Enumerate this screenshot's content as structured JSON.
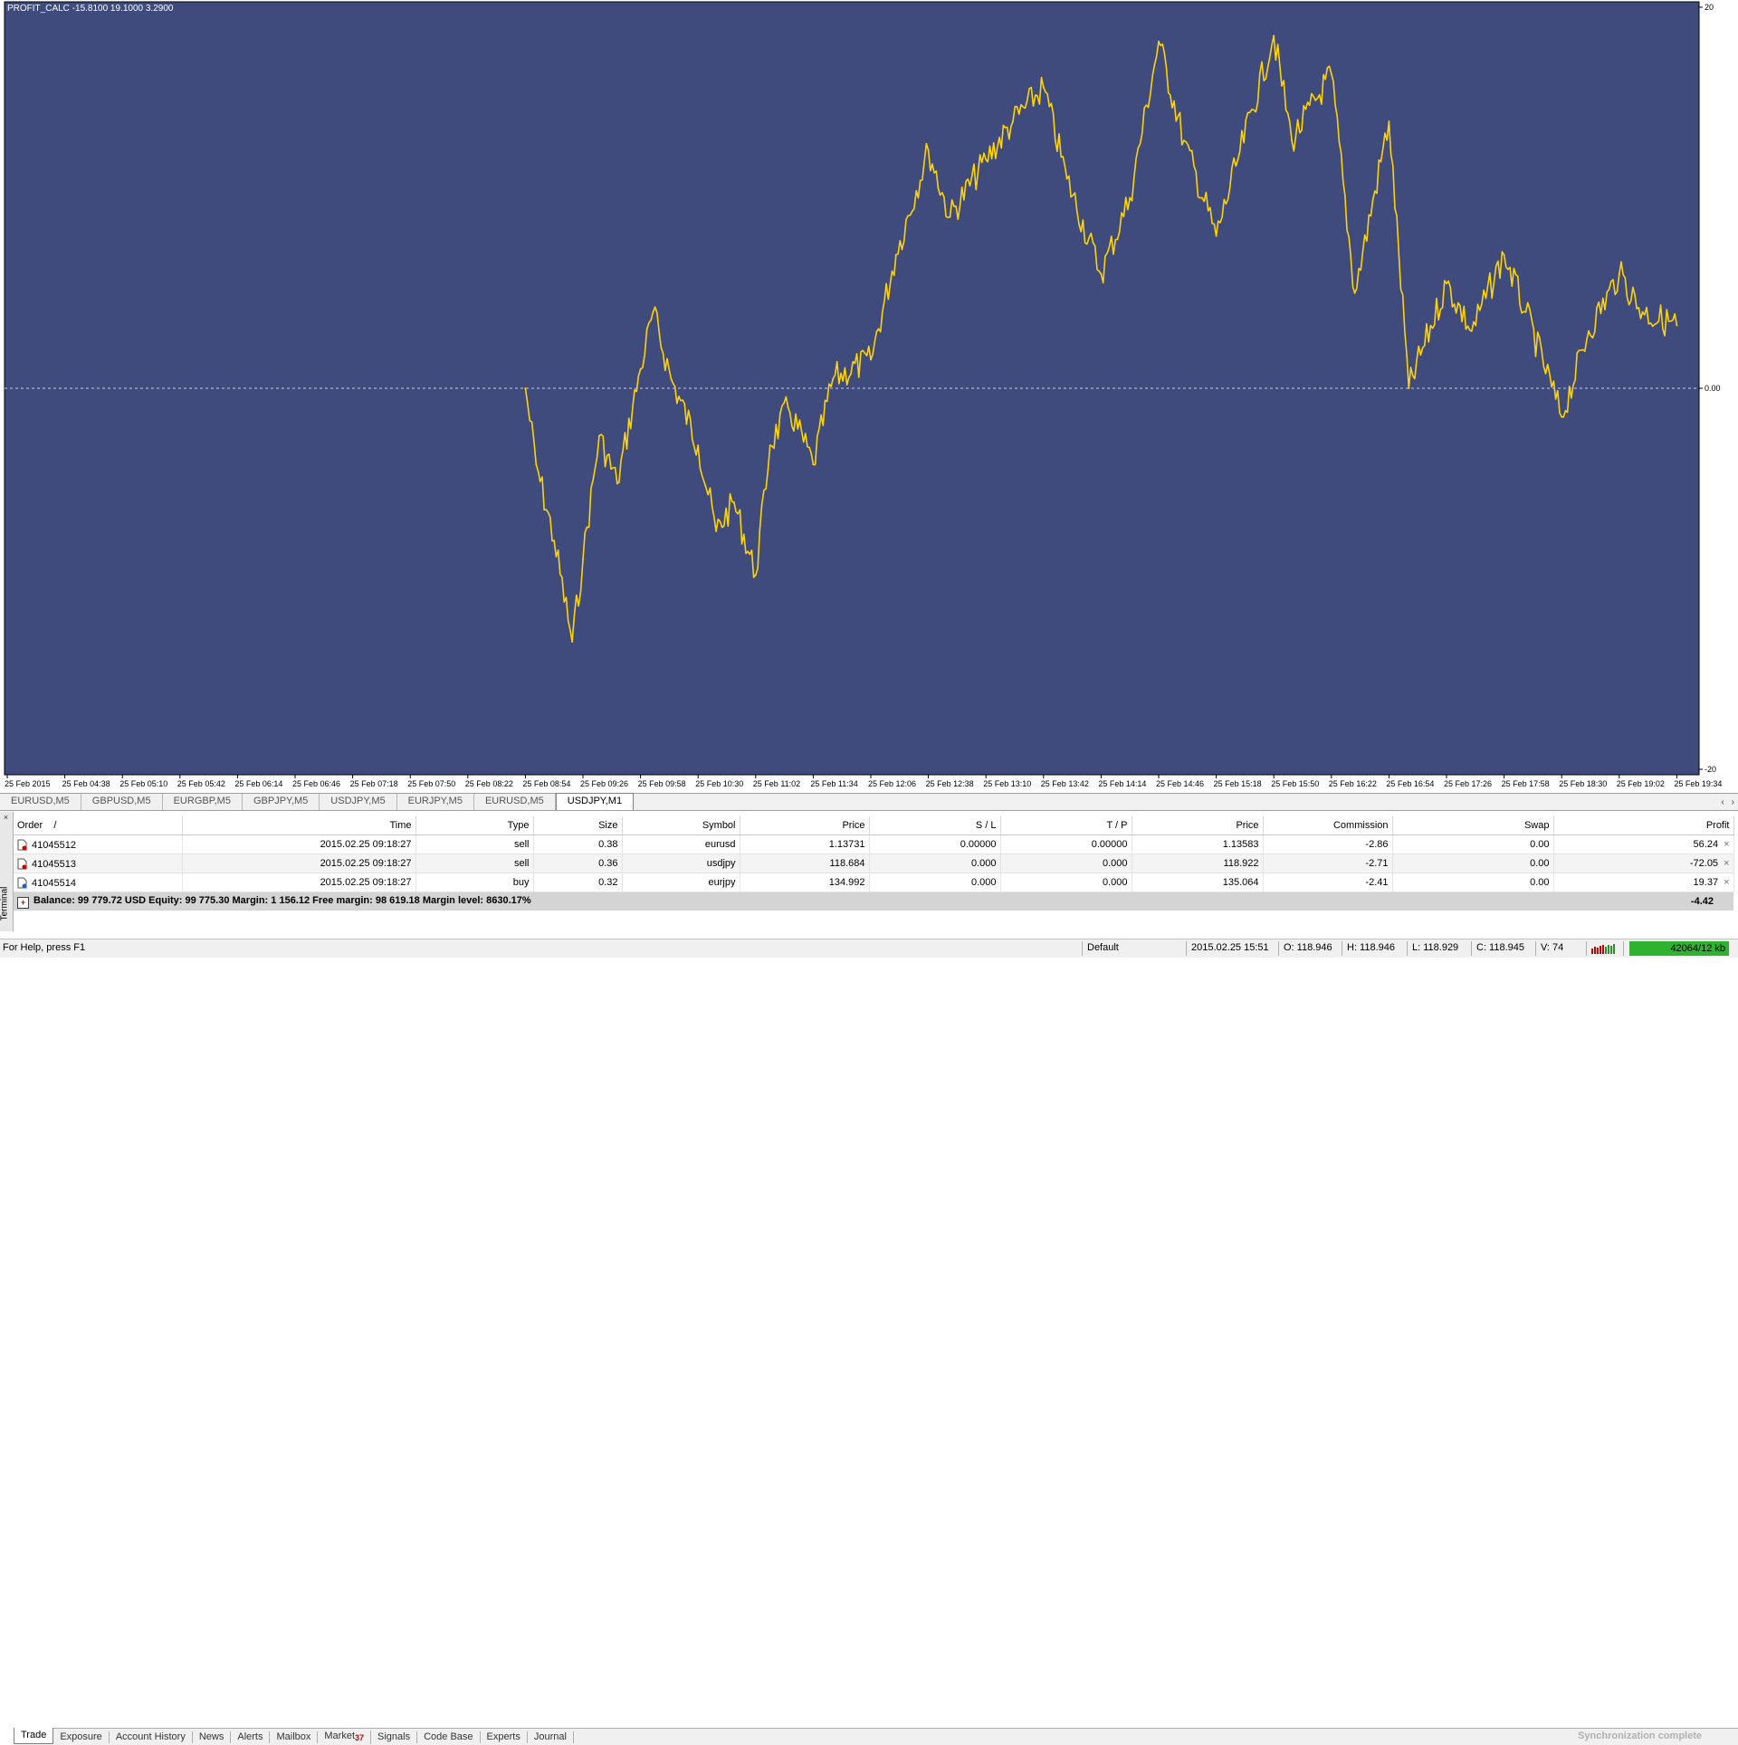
{
  "chart": {
    "title": "PROFIT_CALC -15.8100 19.1000 3.2900",
    "background": "#3f4a7d",
    "line_color": "#ffd400",
    "y_ticks": [
      "20",
      "0.00",
      "-20"
    ],
    "x_ticks": [
      "25 Feb 2015",
      "25 Feb 04:38",
      "25 Feb 05:10",
      "25 Feb 05:42",
      "25 Feb 06:14",
      "25 Feb 06:46",
      "25 Feb 07:18",
      "25 Feb 07:50",
      "25 Feb 08:22",
      "25 Feb 08:54",
      "25 Feb 09:26",
      "25 Feb 09:58",
      "25 Feb 10:30",
      "25 Feb 11:02",
      "25 Feb 11:34",
      "25 Feb 12:06",
      "25 Feb 12:38",
      "25 Feb 13:10",
      "25 Feb 13:42",
      "25 Feb 14:14",
      "25 Feb 14:46",
      "25 Feb 15:18",
      "25 Feb 15:50",
      "25 Feb 16:22",
      "25 Feb 16:54",
      "25 Feb 17:26",
      "25 Feb 17:58",
      "25 Feb 18:30",
      "25 Feb 19:02",
      "25 Feb 19:34"
    ]
  },
  "chart_data": {
    "type": "line",
    "title": "PROFIT_CALC -15.8100 19.1000 3.2900",
    "ylim": [
      -20,
      20
    ],
    "x": [
      "25 Feb 08:54",
      "25 Feb 09:00",
      "25 Feb 09:10",
      "25 Feb 09:20",
      "25 Feb 09:26",
      "25 Feb 09:35",
      "25 Feb 09:45",
      "25 Feb 09:58",
      "25 Feb 10:05",
      "25 Feb 10:15",
      "25 Feb 10:30",
      "25 Feb 10:40",
      "25 Feb 10:50",
      "25 Feb 11:02",
      "25 Feb 11:10",
      "25 Feb 11:20",
      "25 Feb 11:34",
      "25 Feb 11:45",
      "25 Feb 12:06",
      "25 Feb 12:20",
      "25 Feb 12:38",
      "25 Feb 12:50",
      "25 Feb 13:10",
      "25 Feb 13:25",
      "25 Feb 13:42",
      "25 Feb 13:55",
      "25 Feb 14:14",
      "25 Feb 14:30",
      "25 Feb 14:46",
      "25 Feb 15:00",
      "25 Feb 15:18",
      "25 Feb 15:30",
      "25 Feb 15:50",
      "25 Feb 16:00",
      "25 Feb 16:22",
      "25 Feb 16:35",
      "25 Feb 16:54",
      "25 Feb 17:05",
      "25 Feb 17:26",
      "25 Feb 17:40",
      "25 Feb 17:58",
      "25 Feb 18:10",
      "25 Feb 18:30",
      "25 Feb 18:45",
      "25 Feb 19:02",
      "25 Feb 19:15",
      "25 Feb 19:34"
    ],
    "series": [
      {
        "values": [
          0.0,
          -4.0,
          -8.0,
          -13.3,
          -9.0,
          -2.5,
          -5.0,
          1.0,
          4.0,
          0.5,
          -3.0,
          -7.5,
          -6.0,
          -9.8,
          -3.0,
          -1.0,
          -4.0,
          0.5,
          1.5,
          7.0,
          12.5,
          9.0,
          12.0,
          14.0,
          15.8,
          11.0,
          6.0,
          10.0,
          18.2,
          13.0,
          8.0,
          12.0,
          18.5,
          13.0,
          16.5,
          5.0,
          14.0,
          0.0,
          5.5,
          3.0,
          7.0,
          4.0,
          -1.5,
          3.0,
          6.0,
          4.0,
          3.3
        ]
      }
    ]
  },
  "chart_tabs": [
    "EURUSD,M5",
    "GBPUSD,M5",
    "EURGBP,M5",
    "GBPJPY,M5",
    "USDJPY,M5",
    "EURJPY,M5",
    "EURUSD,M5",
    "USDJPY,M1"
  ],
  "tab_scroll": {
    "left": "‹",
    "right": "›"
  },
  "terminal": {
    "side_close": "×",
    "side_label": "Terminal",
    "headers": {
      "order": "Order",
      "order_sort": "/",
      "time": "Time",
      "type": "Type",
      "size": "Size",
      "symbol": "Symbol",
      "price": "Price",
      "sl": "S / L",
      "tp": "T / P",
      "price2": "Price",
      "commission": "Commission",
      "swap": "Swap",
      "profit": "Profit"
    },
    "rows": [
      {
        "order": "41045512",
        "time": "2015.02.25 09:18:27",
        "type": "sell",
        "size": "0.38",
        "symbol": "eurusd",
        "price": "1.13731",
        "sl": "0.00000",
        "tp": "0.00000",
        "price2": "1.13583",
        "commission": "-2.86",
        "swap": "0.00",
        "profit": "56.24",
        "close": "×"
      },
      {
        "order": "41045513",
        "time": "2015.02.25 09:18:27",
        "type": "sell",
        "size": "0.36",
        "symbol": "usdjpy",
        "price": "118.684",
        "sl": "0.000",
        "tp": "0.000",
        "price2": "118.922",
        "commission": "-2.71",
        "swap": "0.00",
        "profit": "-72.05",
        "close": "×"
      },
      {
        "order": "41045514",
        "time": "2015.02.25 09:18:27",
        "type": "buy",
        "size": "0.32",
        "symbol": "eurjpy",
        "price": "134.992",
        "sl": "0.000",
        "tp": "0.000",
        "price2": "135.064",
        "commission": "-2.41",
        "swap": "0.00",
        "profit": "19.37",
        "close": "×"
      }
    ],
    "summary": {
      "text": "Balance: 99 779.72 USD  Equity: 99 775.30  Margin: 1 156.12  Free margin: 98 619.18  Margin level: 8630.17%",
      "profit": "-4.42"
    },
    "tabs": [
      "Trade",
      "Exposure",
      "Account History",
      "News",
      "Alerts",
      "Mailbox",
      "Market",
      "Signals",
      "Code Base",
      "Experts",
      "Journal"
    ],
    "market_badge": "37",
    "sync_text": "Synchronization complete"
  },
  "status_bar": {
    "help": "For Help, press F1",
    "profile": "Default",
    "datetime": "2015.02.25 15:51",
    "open": "O: 118.946",
    "high": "H: 118.946",
    "low": "L: 118.929",
    "close": "C: 118.945",
    "volume": "V: 74",
    "traffic": "42064/12 kb"
  }
}
